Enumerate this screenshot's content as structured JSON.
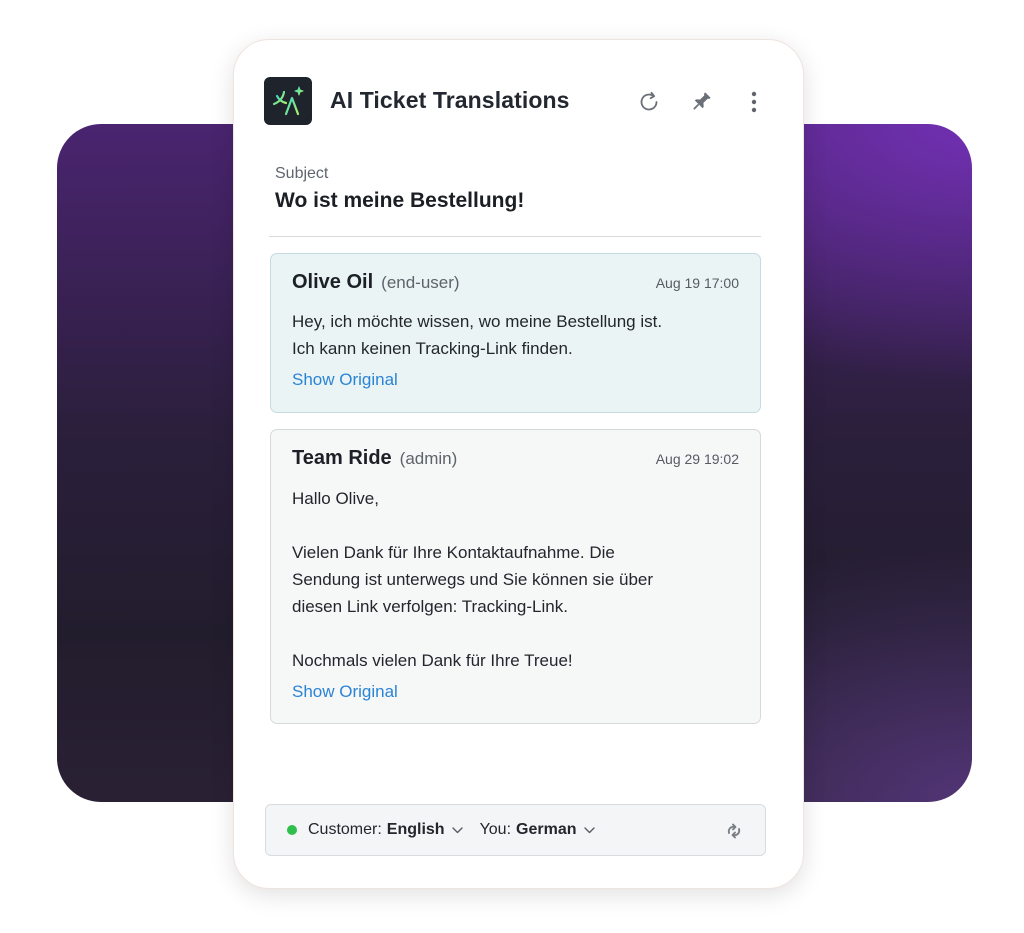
{
  "app": {
    "title": "AI Ticket Translations",
    "icon": "translate-sparkle-icon",
    "actions": [
      "refresh-icon",
      "pin-icon",
      "more-vertical-icon"
    ]
  },
  "ticket": {
    "subject_label": "Subject",
    "subject": "Wo ist meine Bestellung!"
  },
  "messages": [
    {
      "author": "Olive Oil",
      "role": "(end-user)",
      "time": "Aug 19 17:00",
      "body": "Hey, ich möchte wissen, wo meine Bestellung ist.\nIch kann keinen Tracking-Link finden.",
      "link": "Show Original"
    },
    {
      "author": "Team Ride",
      "role": "(admin)",
      "time": "Aug 29 19:02",
      "body": "Hallo Olive,\n\nVielen Dank für Ihre Kontaktaufnahme. Die\nSendung ist unterwegs und Sie können sie über\ndiesen Link verfolgen: Tracking-Link.\n\nNochmals vielen Dank für Ihre Treue!",
      "link": "Show Original"
    }
  ],
  "footer": {
    "customer_label": "Customer:",
    "customer_lang": "English",
    "you_label": "You:",
    "you_lang": "German",
    "status_color": "#2fbf4a"
  },
  "colors": {
    "accent_link": "#2b84d4",
    "end_user_bg": "#eaf4f5",
    "admin_bg": "#f6f7f7",
    "icon_gradient": [
      "#3fd8c0",
      "#a8f06a"
    ]
  }
}
